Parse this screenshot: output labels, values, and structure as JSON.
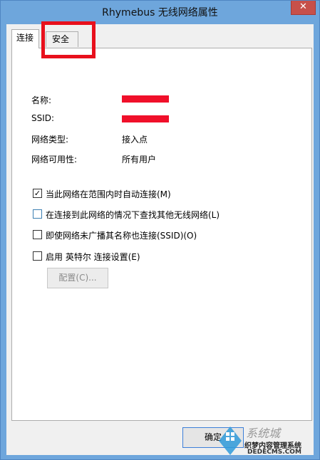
{
  "window": {
    "title": "Rhymebus 无线网络属性",
    "close_glyph": "✕"
  },
  "tabs": [
    {
      "label": "连接",
      "active": true
    },
    {
      "label": "安全",
      "active": false
    }
  ],
  "info": [
    {
      "label": "名称:",
      "value": "",
      "redacted": true
    },
    {
      "label": "SSID:",
      "value": "",
      "redacted": true
    },
    {
      "label": "网络类型:",
      "value": "接入点"
    },
    {
      "label": "网络可用性:",
      "value": "所有用户"
    }
  ],
  "options": [
    {
      "label": "当此网络在范围内时自动连接(M)",
      "checked": true
    },
    {
      "label": "在连接到此网络的情况下查找其他无线网络(L)",
      "checked": false
    },
    {
      "label": "即使网络未广播其名称也连接(SSID)(O)",
      "checked": false
    },
    {
      "label": "启用 英特尔 连接设置(E)",
      "checked": false
    }
  ],
  "buttons": {
    "config": "配置(C)...",
    "ok": "确定"
  },
  "watermark": {
    "site": "系统城",
    "cms": "织梦内容管理系统",
    "url": "DEDECMS.COM"
  },
  "colors": {
    "highlight": "#e8101c",
    "redaction": "#f0102a",
    "title_bar": "#6ea6dc",
    "close_button": "#c7504a"
  }
}
